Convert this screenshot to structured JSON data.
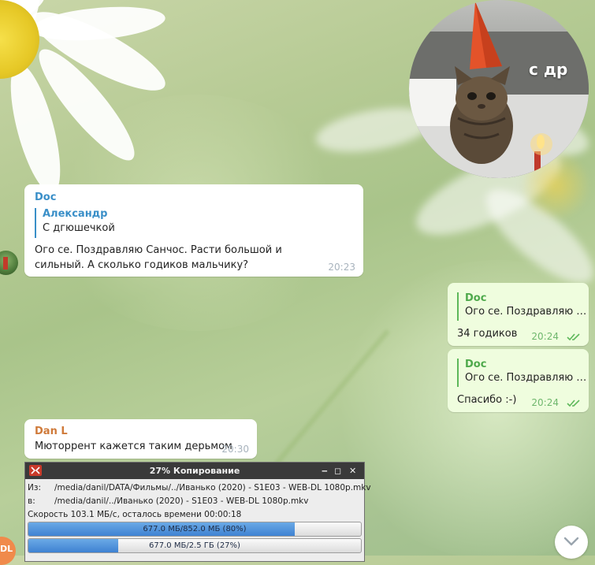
{
  "colors": {
    "incoming_bubble": "#ffffff",
    "outgoing_bubble": "#effdde",
    "sender_blue": "#3a8fc8",
    "sender_orange": "#cf7a3a",
    "outgoing_accent": "#4ea94b",
    "read_ticks": "#5db85a",
    "progress_fill": "#3f82d2"
  },
  "sticker": {
    "caption": "с др",
    "icon": "cat-with-party-hat-sticker"
  },
  "messages": {
    "m1": {
      "sender": "Doc",
      "reply_name": "Александр",
      "reply_text": "С дгюшечкой",
      "text": "Ого се. Поздравляю Санчос. Расти большой и сильный. А сколько годиков мальчику?",
      "time": "20:23"
    },
    "m2": {
      "reply_name": "Doc",
      "reply_text": "Ого се. Поздравляю С...",
      "text": "34 годиков",
      "time": "20:24"
    },
    "m3": {
      "reply_name": "Doc",
      "reply_text": "Ого се. Поздравляю С...",
      "text": "Спасибо :-)",
      "time": "20:24"
    },
    "m4": {
      "sender": "Dan L",
      "text": "Мюторрент кажется таким дерьмом",
      "time": "20:30"
    }
  },
  "avatar_initials": "DL",
  "copy_dialog": {
    "title": "27% Копирование",
    "from_label": "Из:",
    "from_path": "/media/danil/DATA/Фильмы/../Иванько (2020) - S1E03 - WEB-DL 1080p.mkv",
    "to_label": "в:",
    "to_path": "/media/danil/../Иванько (2020) - S1E03 - WEB-DL 1080p.mkv",
    "speed": "Скорость 103.1 МБ/с, осталось времени 00:00:18",
    "file_progress": {
      "label": "677.0 МБ/852.0 МБ (80%)",
      "fraction": 0.8
    },
    "total_progress": {
      "label": "677.0 МБ/2.5 ГБ (27%)",
      "fraction": 0.27
    }
  }
}
